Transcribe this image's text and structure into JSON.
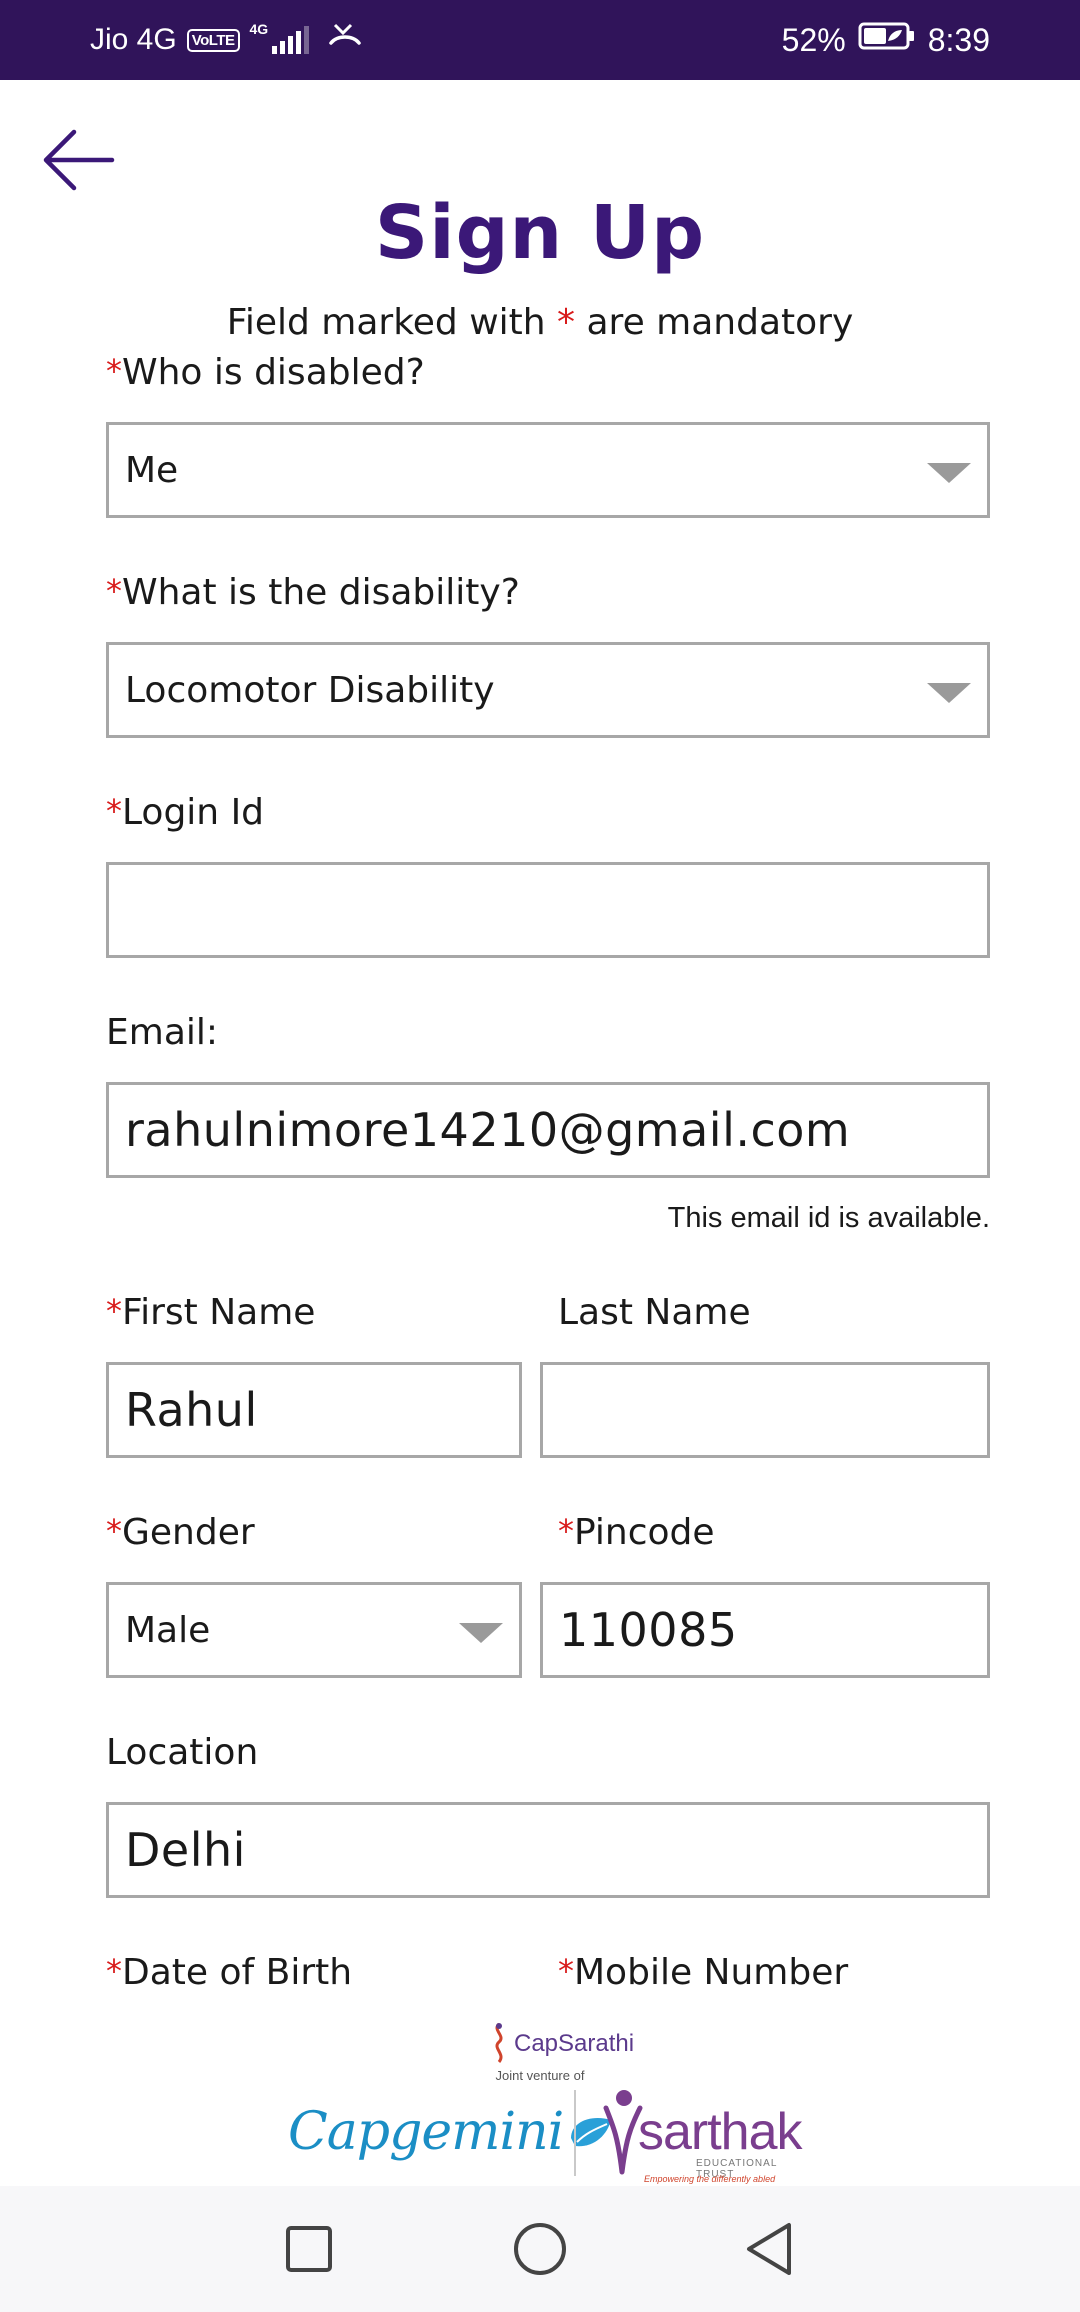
{
  "status_bar": {
    "carrier": "Jio 4G",
    "volte": "VoLTE",
    "network": "4G",
    "battery": "52%",
    "time": "8:39"
  },
  "header": {
    "back_icon": "arrow-left-icon",
    "title": "Sign Up",
    "subtitle_prefix": "Field marked with",
    "subtitle_star": "*",
    "subtitle_suffix": "are mandatory"
  },
  "form": {
    "required_mark": "*",
    "who_disabled": {
      "label": "Who is disabled?",
      "value": "Me"
    },
    "disability": {
      "label": "What is the disability?",
      "value": "Locomotor Disability"
    },
    "login_id": {
      "label": "Login Id",
      "value": ""
    },
    "email": {
      "label": "Email:",
      "value": "rahulnimore14210@gmail.com",
      "hint": "This email id is available."
    },
    "first_name": {
      "label": "First Name",
      "value": "Rahul"
    },
    "last_name": {
      "label": "Last Name",
      "value": ""
    },
    "gender": {
      "label": "Gender",
      "value": "Male"
    },
    "pincode": {
      "label": "Pincode",
      "value": "110085"
    },
    "location": {
      "label": "Location",
      "value": "Delhi"
    },
    "dob": {
      "label": "Date of Birth"
    },
    "mobile": {
      "label": "Mobile Number"
    }
  },
  "footer": {
    "capsarathi": "CapSarathi",
    "joint_venture": "Joint venture of",
    "capgemini": "Capgemini",
    "sarthak": "sarthak",
    "sarthak_sub": "EDUCATIONAL TRUST",
    "sarthak_tagline": "Empowering the differently abled"
  },
  "nav": {
    "recents_icon": "square-icon",
    "home_icon": "circle-icon",
    "back_icon": "triangle-back-icon"
  },
  "colors": {
    "status_bar": "#30145a",
    "title": "#3b1878",
    "required": "#d81b1b",
    "field_border": "#a7a7a7"
  }
}
